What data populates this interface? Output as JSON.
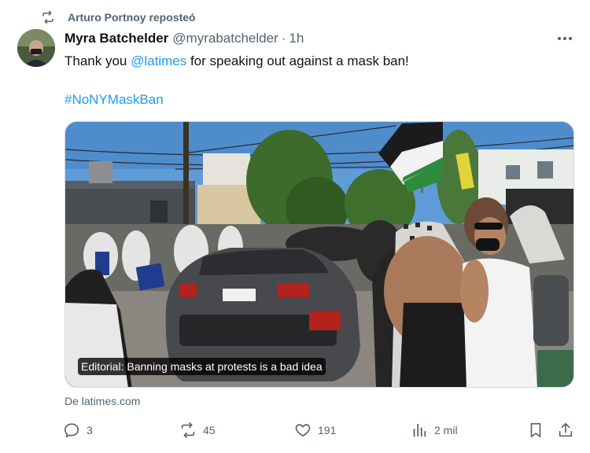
{
  "repost": {
    "text": "Arturo Portnoy reposteó",
    "icon": "repost-icon"
  },
  "post": {
    "author_name": "Myra Batchelder",
    "author_handle": "@myrabatchelder",
    "separator": "·",
    "time": "1h",
    "text_before": "Thank you ",
    "mention": "@latimes",
    "text_after": " for speaking out against a mask ban!",
    "hashtag": "#NoNYMaskBan"
  },
  "card": {
    "caption": "Editorial: Banning masks at protests is a bad idea",
    "source": "De latimes.com"
  },
  "actions": {
    "replies": "3",
    "reposts": "45",
    "likes": "191",
    "views": "2 mil"
  },
  "colors": {
    "accent": "#1d9bf0",
    "secondary_text": "#536471",
    "primary_text": "#0f1419"
  }
}
